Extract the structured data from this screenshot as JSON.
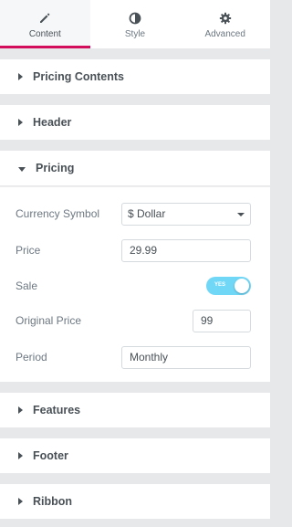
{
  "tabs": [
    {
      "label": "Content",
      "icon": "pencil-icon",
      "active": true
    },
    {
      "label": "Style",
      "icon": "half-circle-icon",
      "active": false
    },
    {
      "label": "Advanced",
      "icon": "gear-icon",
      "active": false
    }
  ],
  "sections": {
    "pricing_contents": "Pricing Contents",
    "header": "Header",
    "pricing": "Pricing",
    "features": "Features",
    "footer": "Footer",
    "ribbon": "Ribbon"
  },
  "pricing": {
    "currency_label": "Currency Symbol",
    "currency_value": "$ Dollar",
    "price_label": "Price",
    "price_value": "29.99",
    "sale_label": "Sale",
    "sale_toggle_text": "YES",
    "original_price_label": "Original Price",
    "original_price_value": "99",
    "period_label": "Period",
    "period_value": "Monthly"
  },
  "colors": {
    "accent": "#d30c5c",
    "toggle_on": "#71d7f7",
    "heading": "#495157",
    "label": "#6d7882"
  }
}
